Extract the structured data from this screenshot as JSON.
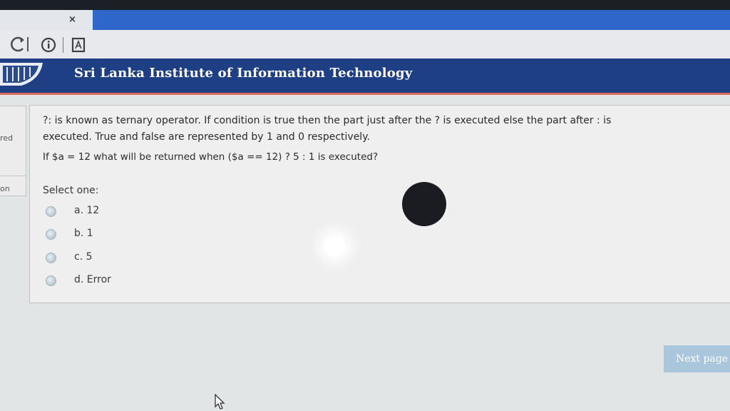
{
  "browser": {
    "tab_close": "×",
    "icons": [
      "reload-icon",
      "info-icon",
      "reader-mode-icon"
    ]
  },
  "header": {
    "title": "Sri Lanka Institute of Information Technology",
    "color": "#1f3f85",
    "accent": "#e06a5a"
  },
  "sidebar": {
    "label_1": "red",
    "label_2": "on"
  },
  "question": {
    "line1": "?: is known as ternary operator. If condition is true then the part just after the ? is executed else the part after : is",
    "line2": "executed. True and false are represented by 1 and 0 respectively.",
    "line3": "If $a = 12 what will be returned when ($a == 12) ? 5 : 1 is executed?",
    "prompt": "Select one:",
    "options": [
      {
        "label": "a. 12"
      },
      {
        "label": "b. 1"
      },
      {
        "label": "c. 5"
      },
      {
        "label": "d. Error"
      }
    ]
  },
  "navigation": {
    "next_label": "Next page"
  }
}
